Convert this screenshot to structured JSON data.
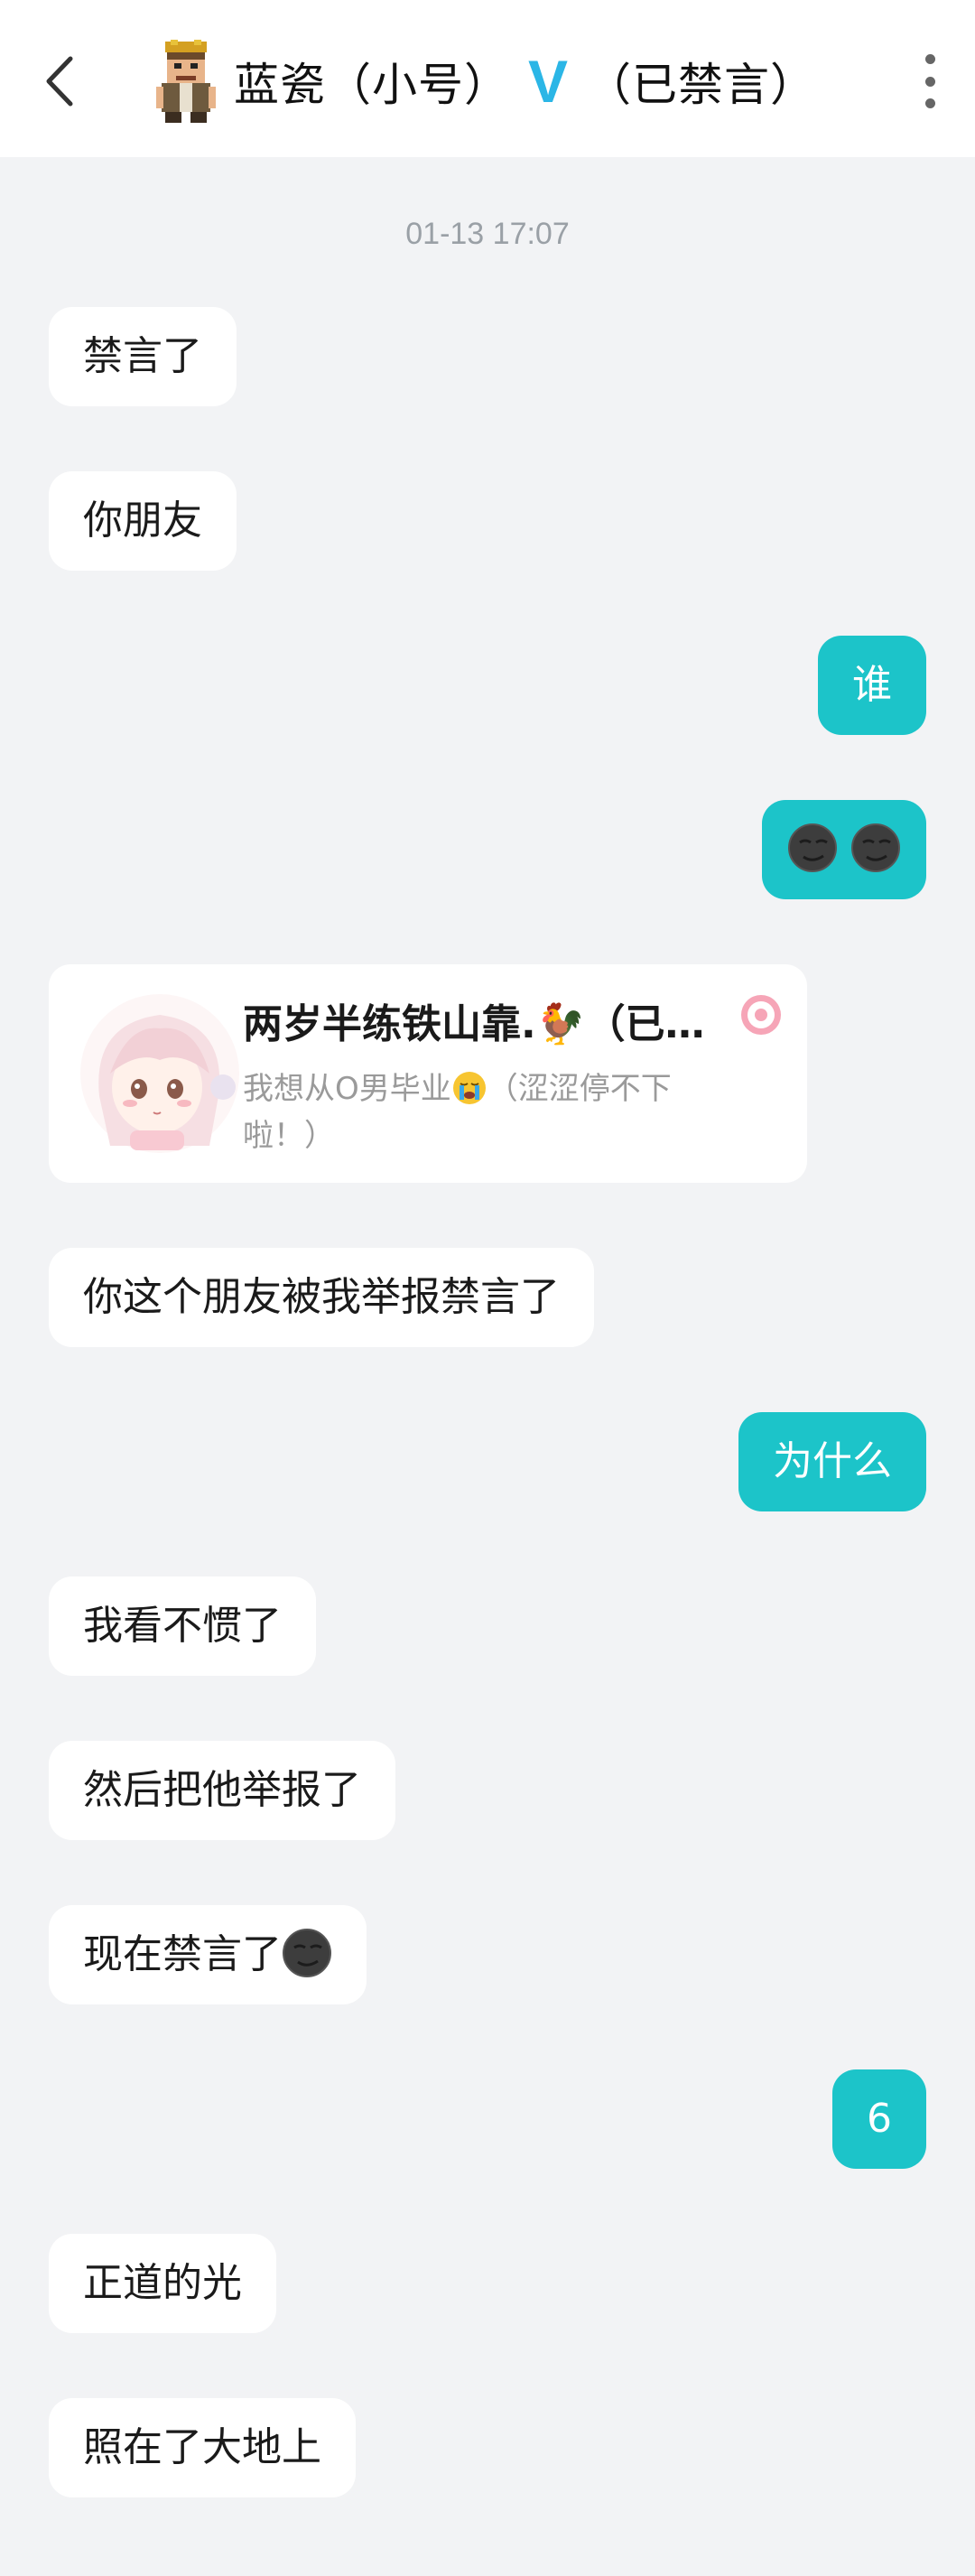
{
  "header": {
    "title_name": "蓝瓷（小号）",
    "verified_mark": "V",
    "title_status": "（已禁言）"
  },
  "timestamp": "01-13 17:07",
  "messages": [
    {
      "side": "left",
      "text": "禁言了"
    },
    {
      "side": "left",
      "text": "你朋友"
    },
    {
      "side": "right",
      "text": "谁"
    },
    {
      "side": "right",
      "emoji": "smirk-moon-emoji x2"
    },
    {
      "side": "left",
      "type": "profile-card"
    },
    {
      "side": "left",
      "text": "你这个朋友被我举报禁言了"
    },
    {
      "side": "right",
      "text": "为什么"
    },
    {
      "side": "left",
      "text": "我看不惯了"
    },
    {
      "side": "left",
      "text": "然后把他举报了"
    },
    {
      "side": "left",
      "text": "现在禁言了",
      "emoji": "smirk-moon-emoji"
    },
    {
      "side": "right",
      "text": "6"
    },
    {
      "side": "left",
      "text": "正道的光"
    },
    {
      "side": "left",
      "text": "照在了大地上"
    }
  ],
  "card": {
    "name": "两岁半练铁山靠.🐓（已…",
    "desc_before": "我想从O男毕业",
    "desc_after": "（涩涩停不下啦！）"
  },
  "colors": {
    "accent_bubble": "#1cc4c9",
    "verified": "#2bb6e6",
    "background": "#f2f3f5"
  }
}
